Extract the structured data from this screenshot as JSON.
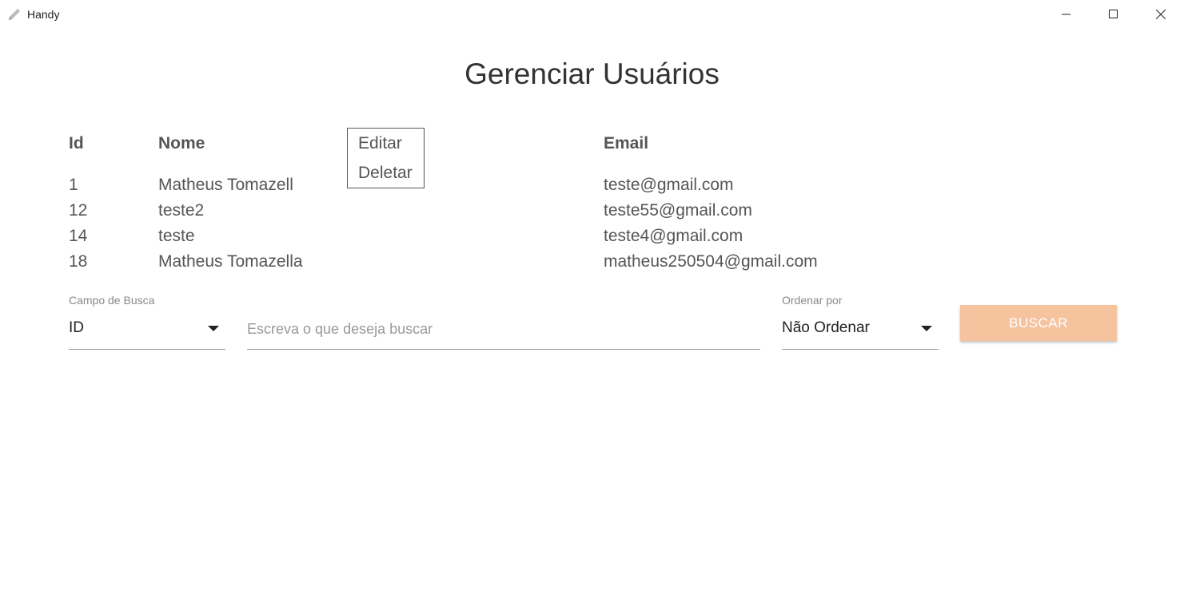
{
  "window": {
    "title": "Handy",
    "icon": "pencil-icon"
  },
  "page": {
    "title": "Gerenciar Usuários"
  },
  "table": {
    "headers": {
      "id": "Id",
      "nome": "Nome",
      "email": "Email"
    },
    "rows": [
      {
        "id": "1",
        "nome": "Matheus Tomazell",
        "email": "teste@gmail.com"
      },
      {
        "id": "12",
        "nome": "teste2",
        "email": "teste55@gmail.com"
      },
      {
        "id": "14",
        "nome": "teste",
        "email": "teste4@gmail.com"
      },
      {
        "id": "18",
        "nome": "Matheus Tomazella",
        "email": "matheus250504@gmail.com"
      }
    ]
  },
  "context_menu": {
    "items": [
      "Editar",
      "Deletar"
    ]
  },
  "search": {
    "field_label": "Campo de Busca",
    "field_value": "ID",
    "input_placeholder": "Escreva o que deseja buscar",
    "input_value": "",
    "order_label": "Ordenar por",
    "order_value": "Não Ordenar",
    "button_label": "BUSCAR"
  },
  "colors": {
    "button_bg": "#f6c39f",
    "text": "#555555"
  }
}
